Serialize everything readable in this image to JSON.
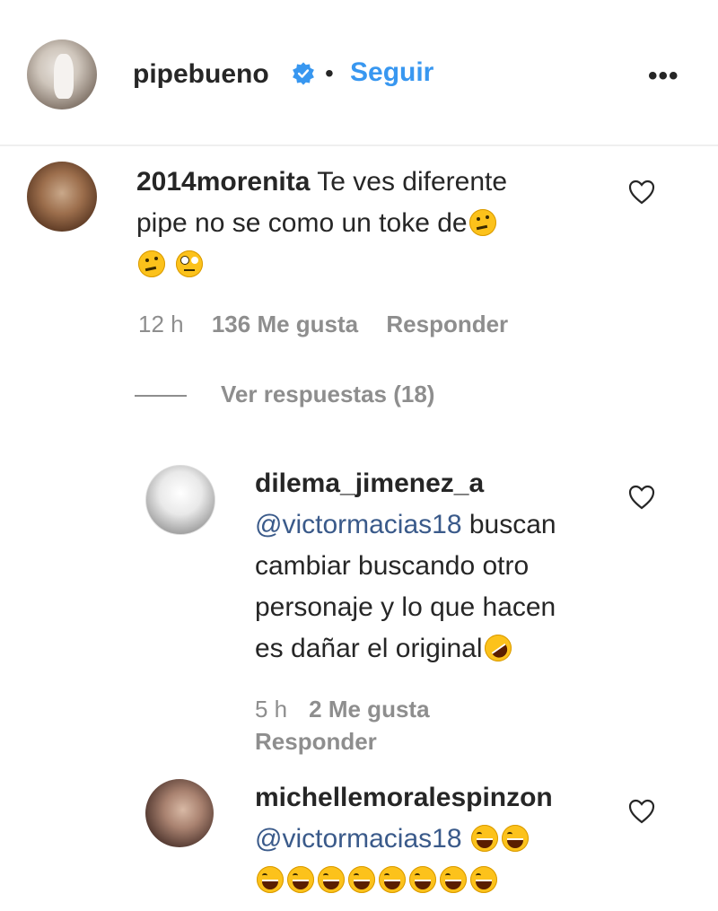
{
  "post": {
    "username": "pipebueno",
    "separator": "•",
    "follow_label": "Seguir",
    "more_label": "•••"
  },
  "comments": [
    {
      "username": "2014morenita",
      "text": "Te ves diferente",
      "text_line2": "pipe no se como un toke de",
      "time": "12 h",
      "likes": "136 Me gusta",
      "reply_label": "Responder"
    }
  ],
  "view_replies_label": "Ver respuestas (18)",
  "replies": [
    {
      "username": "dilema_jimenez_a",
      "mention": "@victormacias18",
      "text": "buscan",
      "text_line2": "cambiar buscando otro",
      "text_line3": "personaje y lo que hacen",
      "text_line4": "es dañar el original",
      "time": "5 h",
      "likes": "2 Me gusta",
      "reply_label": "Responder"
    },
    {
      "username": "michellemoralespinzon",
      "mention": "@victormacias18"
    }
  ],
  "colors": {
    "accent": "#3897f0",
    "muted": "#8e8e8e",
    "text": "#262626"
  },
  "icons": [
    "verified-badge-icon",
    "heart-icon",
    "more-options-icon"
  ]
}
